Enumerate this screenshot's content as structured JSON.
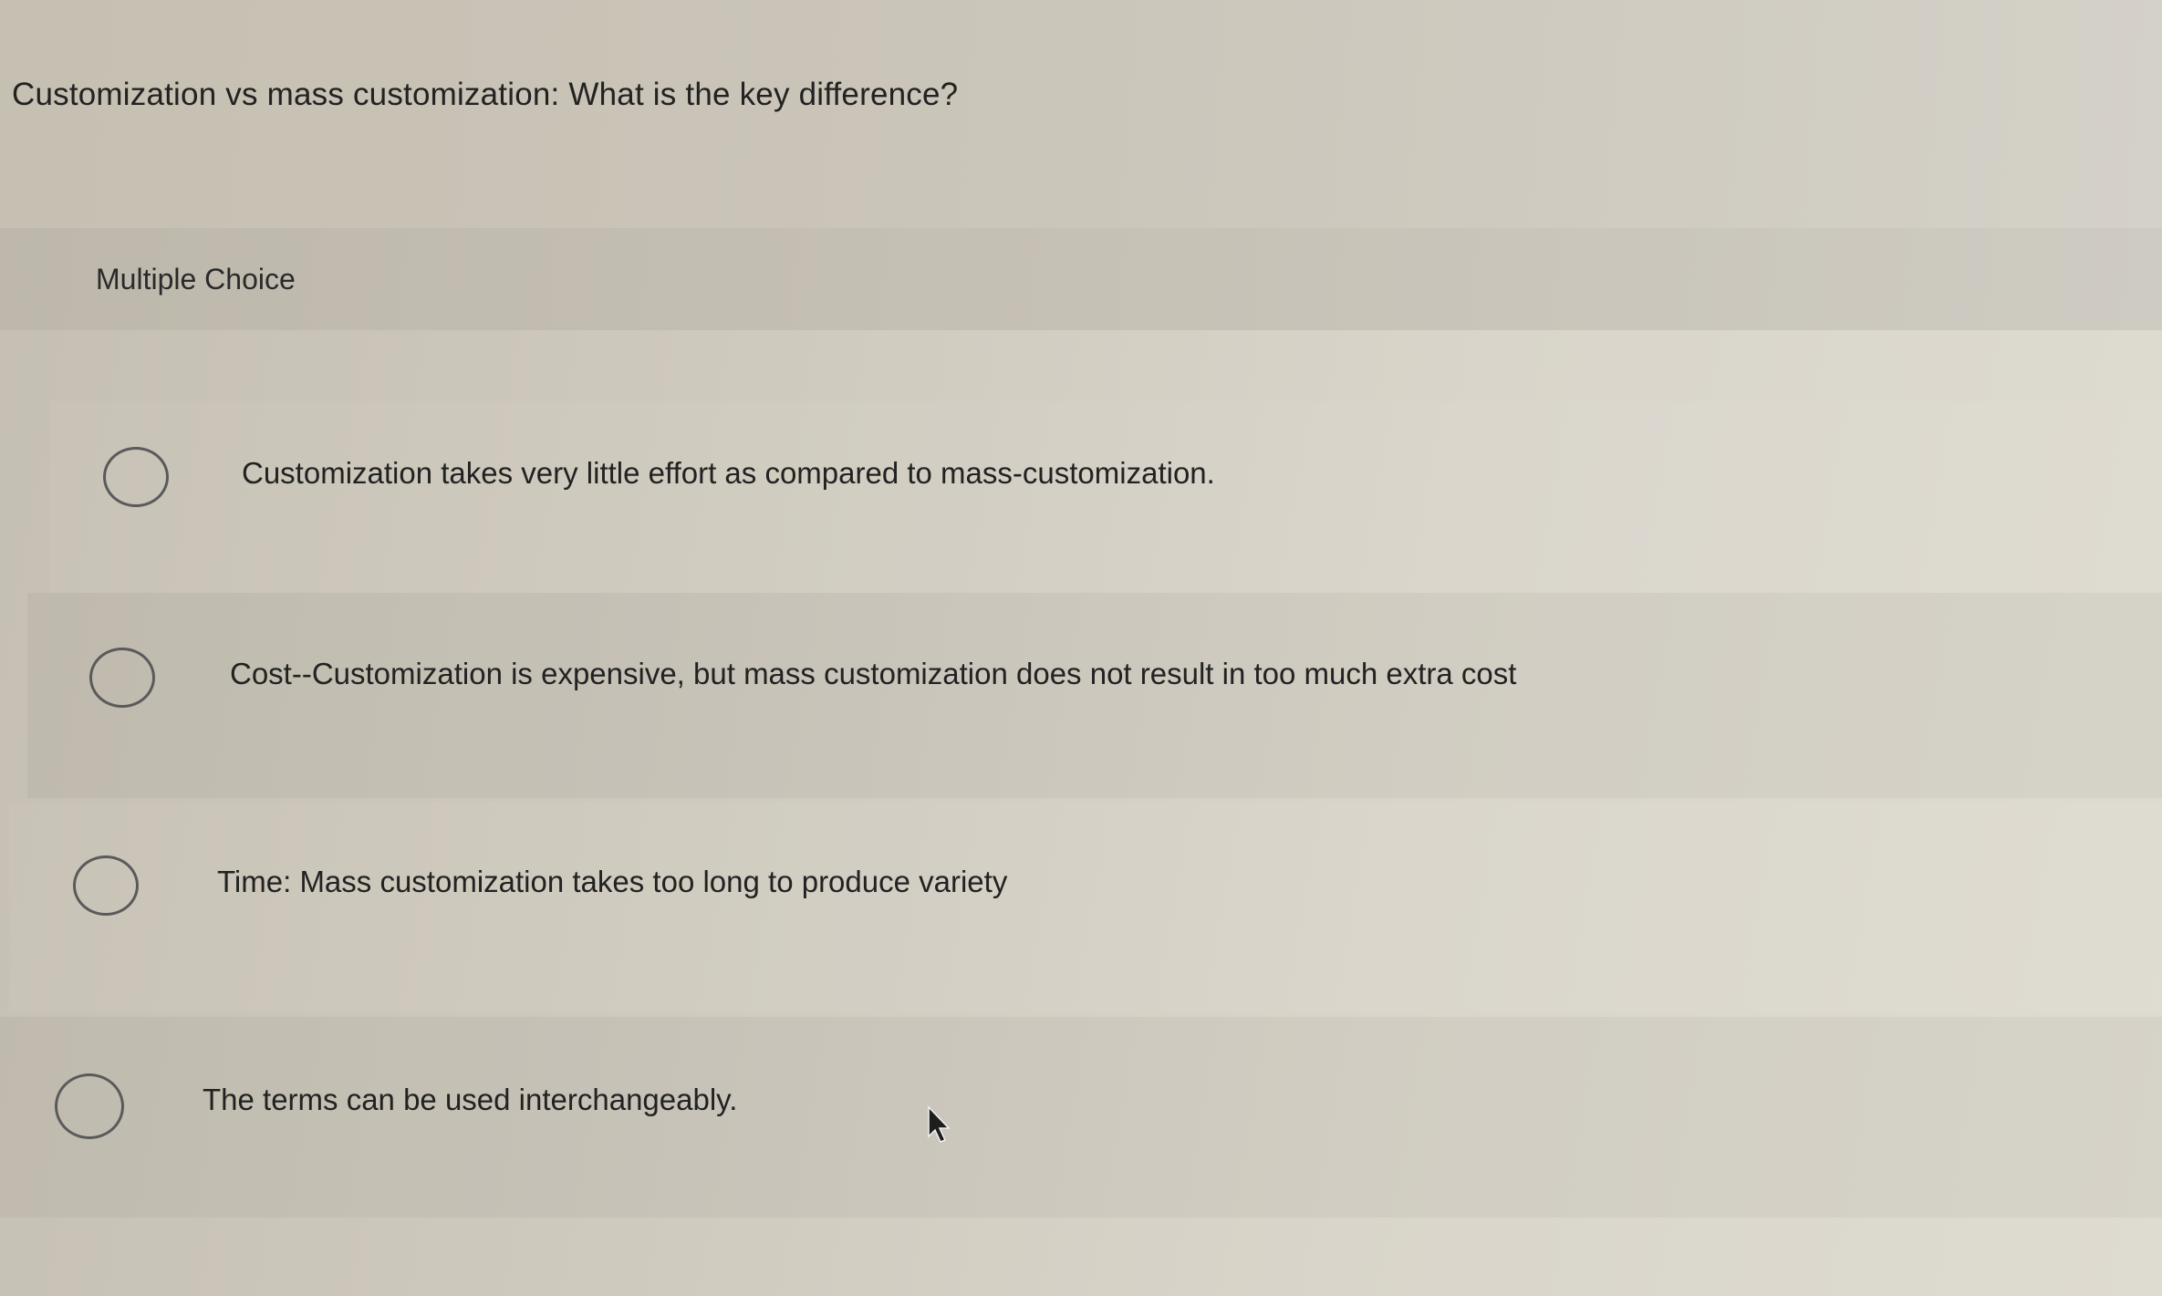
{
  "question": {
    "text": "Customization vs mass customization: What is the key difference?"
  },
  "question_type": {
    "label": "Multiple Choice"
  },
  "options": [
    {
      "label": "Customization takes very little effort as compared to mass-customization.",
      "selected": false
    },
    {
      "label": "Cost--Customization is expensive, but mass customization does not result in too much extra cost",
      "selected": false
    },
    {
      "label": "Time:  Mass customization takes too long to produce variety",
      "selected": false
    },
    {
      "label": "The terms can be used interchangeably.",
      "selected": false
    }
  ],
  "icons": {
    "radio": "radio-button-unselected-icon",
    "cursor": "mouse-pointer-icon"
  }
}
